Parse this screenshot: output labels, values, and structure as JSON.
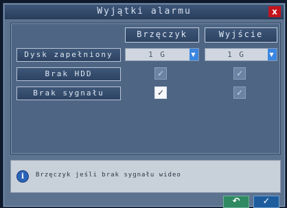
{
  "dialog": {
    "title": "Wyjątki alarmu",
    "close_label": "x"
  },
  "columns": {
    "buzzer": "Brzęczyk",
    "output": "Wyjście"
  },
  "rows": [
    {
      "label": "Dysk zapełniony",
      "type": "select",
      "buzzer_value": "1 G",
      "output_value": "1 G"
    },
    {
      "label": "Brak HDD",
      "type": "checkbox",
      "buzzer_checked": false,
      "output_checked": false
    },
    {
      "label": "Brak sygnału",
      "type": "checkbox",
      "buzzer_checked": true,
      "output_checked": false
    }
  ],
  "icons": {
    "check": "✓",
    "dropdown": "▼",
    "info": "i"
  },
  "info": {
    "text": "Brzęczyk jeśli brak sygnału wideo"
  },
  "footer": {
    "back_label": "↶",
    "ok_label": "✓"
  },
  "colors": {
    "accent": "#3a86e0",
    "close": "#c3141c",
    "back_button": "#2f8a62",
    "ok_button": "#1d5d9e"
  }
}
